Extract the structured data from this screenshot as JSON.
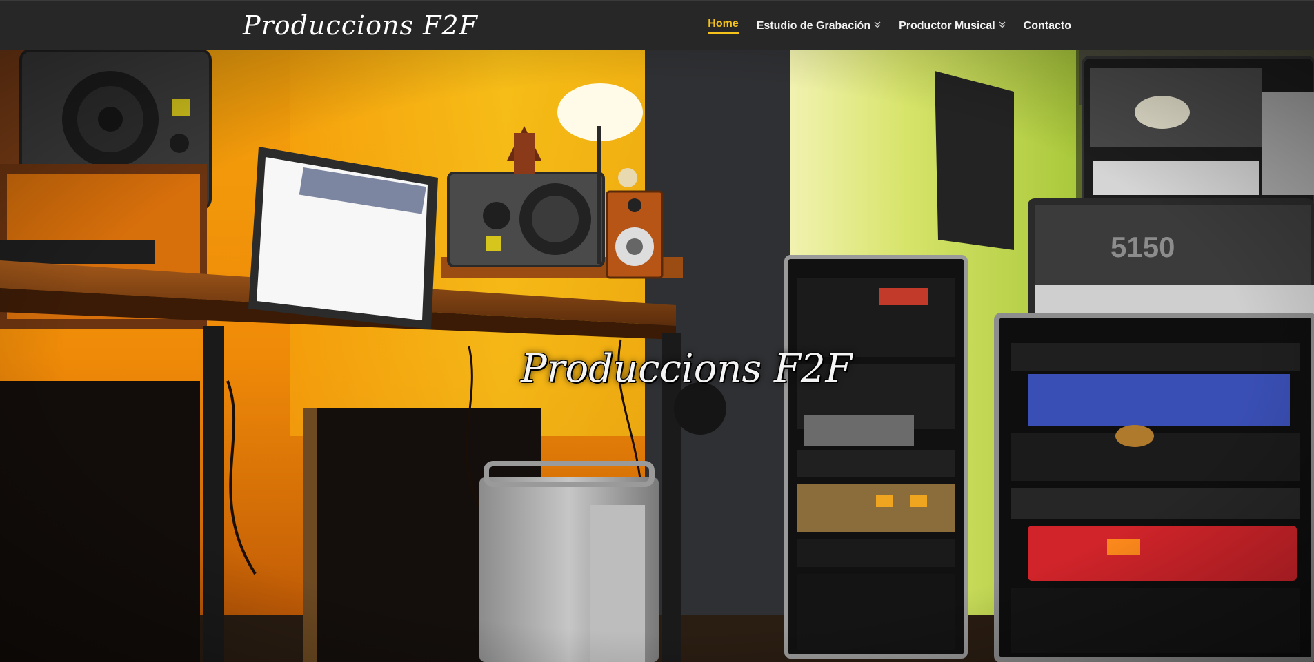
{
  "header": {
    "logo_text": "Produccions F2F",
    "nav": [
      {
        "label": "Home",
        "active": true,
        "has_dropdown": false
      },
      {
        "label": "Estudio de Grabación",
        "active": false,
        "has_dropdown": true
      },
      {
        "label": "Productor Musical",
        "active": false,
        "has_dropdown": true
      },
      {
        "label": "Contacto",
        "active": false,
        "has_dropdown": false
      }
    ],
    "accent_color": "#f4c21b",
    "background_color": "#272727"
  },
  "hero": {
    "title": "Produccions F2F",
    "image_description_icon": "recording-studio-photo",
    "amp_label": "5150"
  }
}
